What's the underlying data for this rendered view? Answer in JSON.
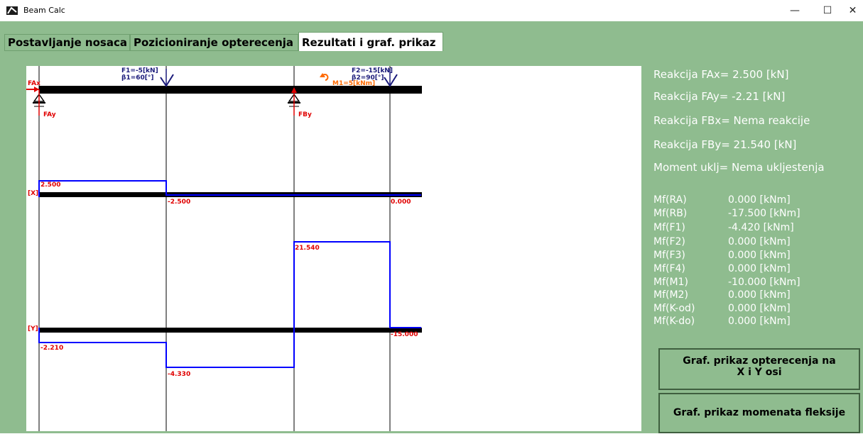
{
  "window": {
    "title": "Beam Calc",
    "minimize": "—",
    "maximize": "☐",
    "close": "✕"
  },
  "tabs": [
    {
      "label": "Postavljanje nosaca"
    },
    {
      "label": "Pozicioniranje opterecenja"
    },
    {
      "label": "Rezultati i  graf. prikaz"
    }
  ],
  "diagram": {
    "fax_label": "FAx",
    "fay_label": "FAy",
    "fby_label": "FBy",
    "f1_line1": "F1=-5[kN]",
    "f1_line2": "β1=60[°]",
    "f2_line1": "F2=-15[kN]",
    "f2_line2": "β2=90[°]",
    "m1_label": "M1=5[kNm]",
    "x_axis_label": "[X]",
    "y_axis_label": "[Y]",
    "x_values": [
      "2.500",
      "-2.500",
      "0.000"
    ],
    "y_values": [
      "-2.210",
      "-4.330",
      "21.540",
      "-15.000"
    ]
  },
  "results": {
    "fax": "Reakcija FAx= 2.500 [kN]",
    "fay": "Reakcija FAy= -2.21 [kN]",
    "fbx": "Reakcija FBx= Nema reakcije",
    "fby": "Reakcija FBy= 21.540 [kN]",
    "moment": "Moment uklj= Nema uklјestenja"
  },
  "moments": [
    {
      "label": "Mf(RA)",
      "value": "0.000 [kNm]"
    },
    {
      "label": "Mf(RB)",
      "value": "-17.500 [kNm]"
    },
    {
      "label": "Mf(F1)",
      "value": "-4.420 [kNm]"
    },
    {
      "label": "Mf(F2)",
      "value": "0.000 [kNm]"
    },
    {
      "label": "Mf(F3)",
      "value": "0.000 [kNm]"
    },
    {
      "label": "Mf(F4)",
      "value": "0.000 [kNm]"
    },
    {
      "label": "Mf(M1)",
      "value": "-10.000 [kNm]"
    },
    {
      "label": "Mf(M2)",
      "value": "0.000 [kNm]"
    },
    {
      "label": "Mf(K-od)",
      "value": "0.000 [kNm]"
    },
    {
      "label": "Mf(K-do)",
      "value": "0.000 [kNm]"
    }
  ],
  "buttons": {
    "load_graph_line1": "Graf. prikaz opterecenja na",
    "load_graph_line2": "X i Y osi",
    "moment_graph": "Graf. prikaz momenata fleksije"
  },
  "colors": {
    "background": "#8fbc8f",
    "diagram_line": "#0000ff",
    "labels_red": "#e00000",
    "force_navy": "#1a1a7a",
    "moment_orange": "#ff6a00"
  }
}
